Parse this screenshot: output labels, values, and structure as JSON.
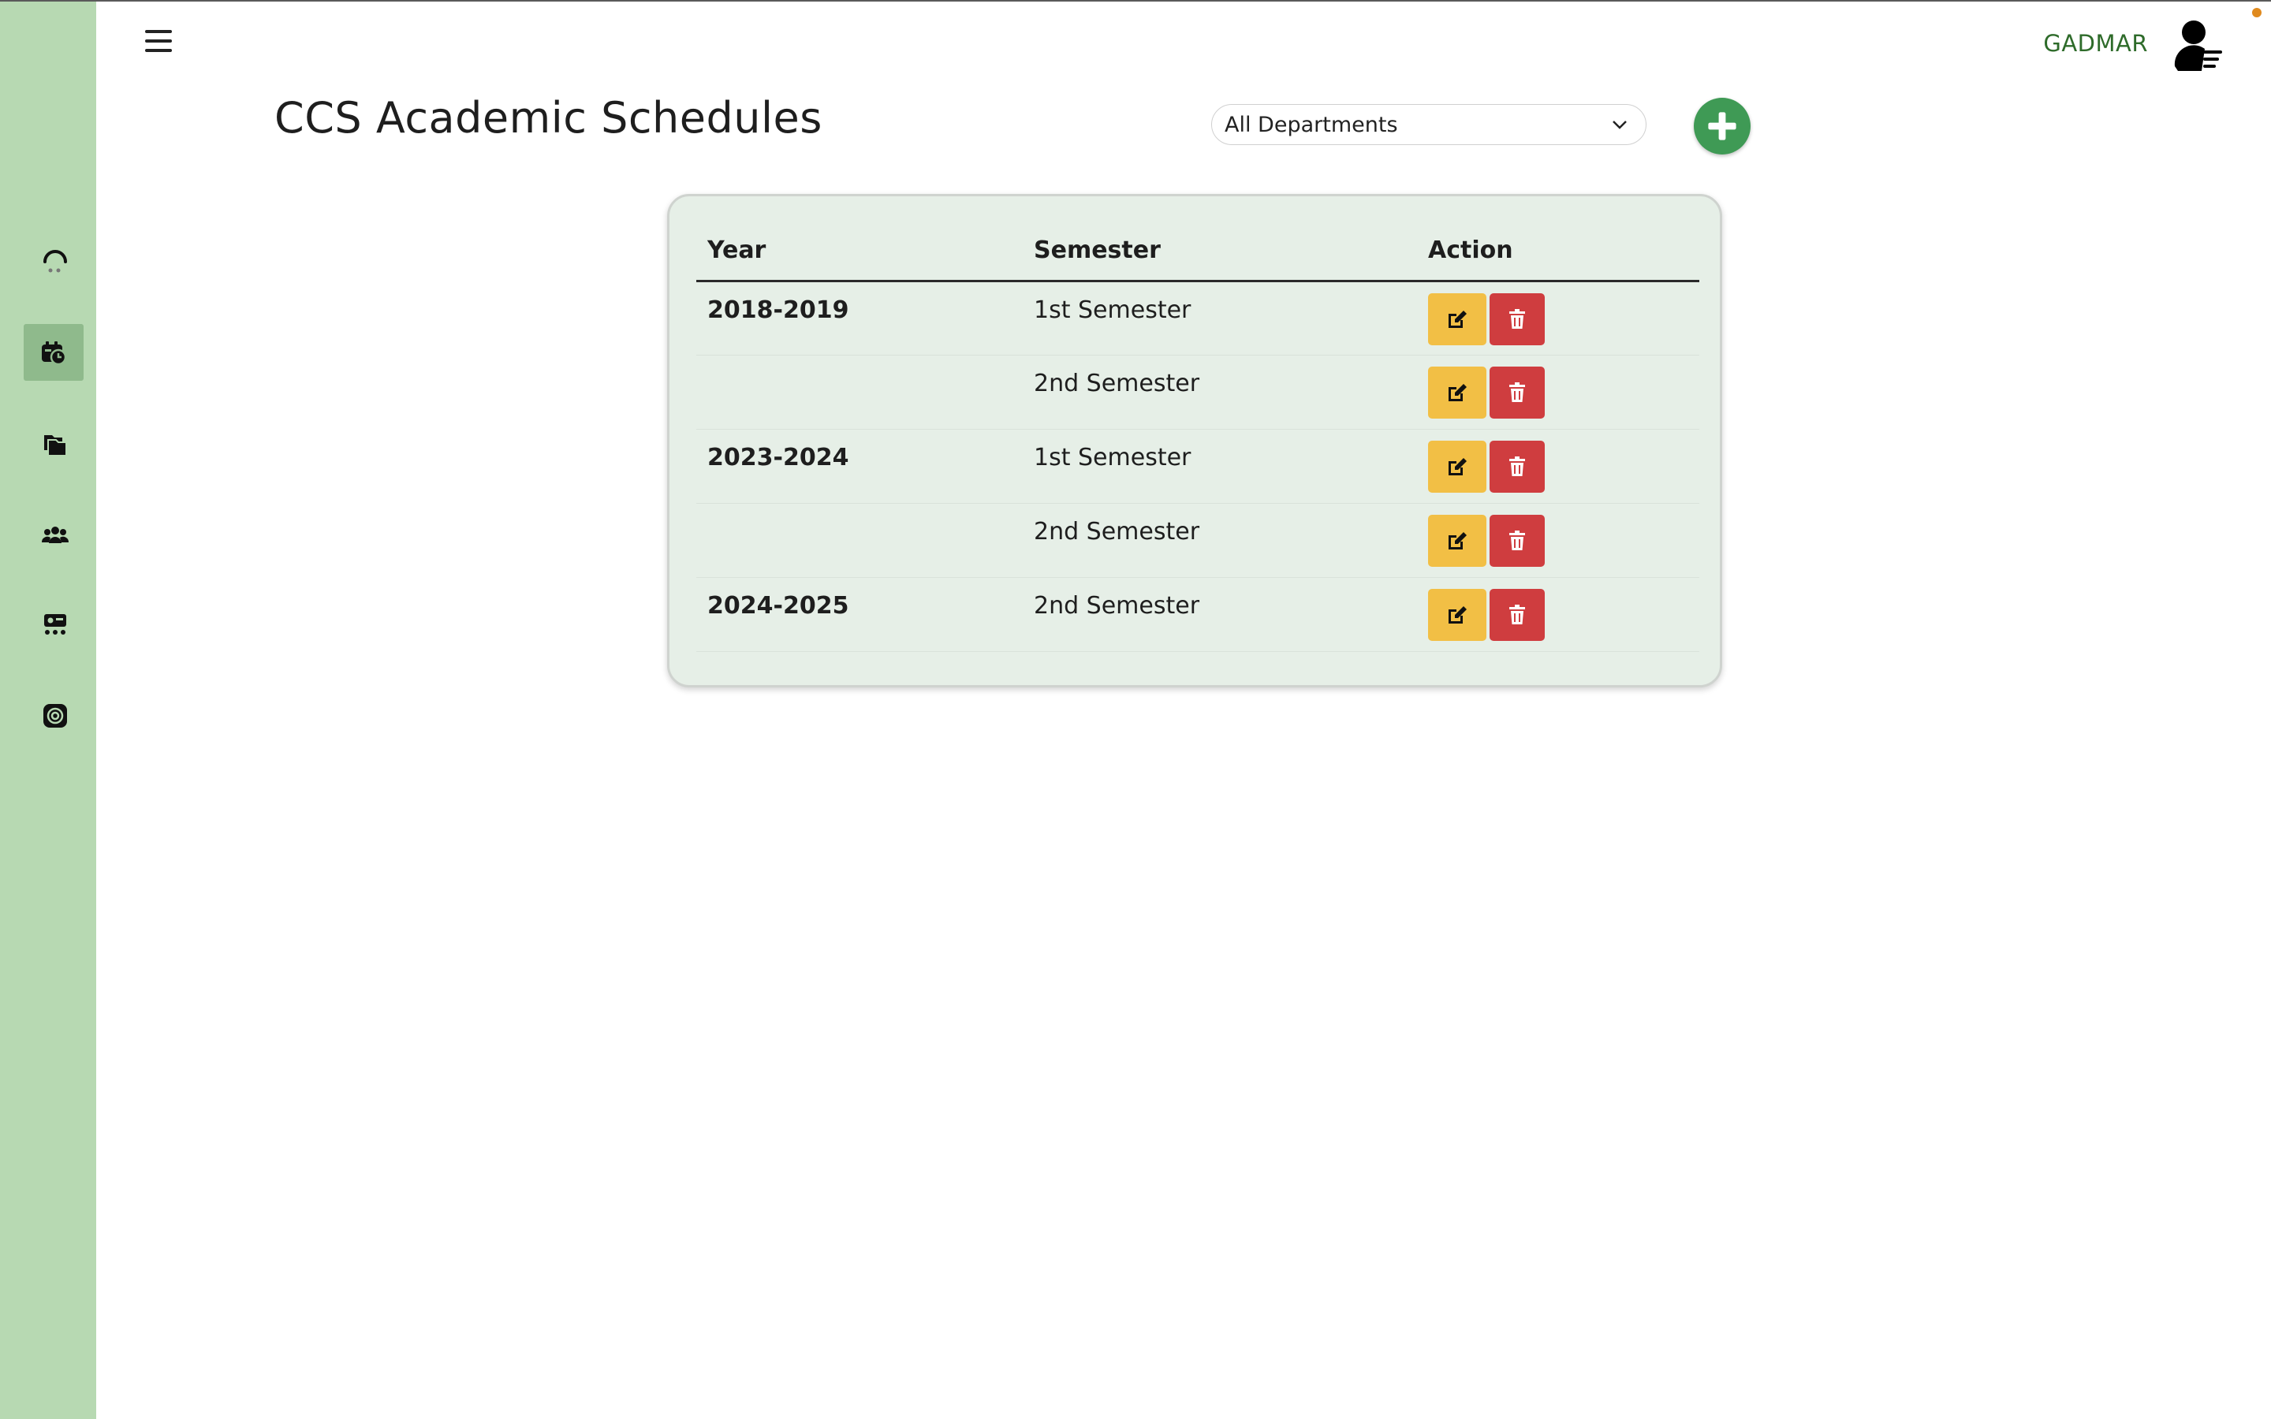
{
  "header": {
    "username": "GADMAR"
  },
  "page": {
    "title": "CCS Academic Schedules"
  },
  "filter": {
    "selected": "All Departments"
  },
  "sidebar": {
    "items": [
      {
        "icon": "loading-icon",
        "active": false
      },
      {
        "icon": "schedule-icon",
        "active": true
      },
      {
        "icon": "files-icon",
        "active": false
      },
      {
        "icon": "users-icon",
        "active": false
      },
      {
        "icon": "user-grid-icon",
        "active": false
      },
      {
        "icon": "settings-cog-icon",
        "active": false
      }
    ]
  },
  "table": {
    "headers": [
      "Year",
      "Semester",
      "Action"
    ],
    "rows": [
      {
        "year": "2018-2019",
        "semester": "1st Semester"
      },
      {
        "year": "",
        "semester": "2nd Semester"
      },
      {
        "year": "2023-2024",
        "semester": "1st Semester"
      },
      {
        "year": "",
        "semester": "2nd Semester"
      },
      {
        "year": "2024-2025",
        "semester": "2nd Semester"
      }
    ]
  },
  "colors": {
    "sidebar": "#b7d9b2",
    "sidebar_active": "#8fba8c",
    "accent_green": "#3f9a55",
    "edit": "#f2bf45",
    "delete": "#cf3d3f",
    "card": "#e6efe7",
    "username": "#2e6b2a"
  }
}
